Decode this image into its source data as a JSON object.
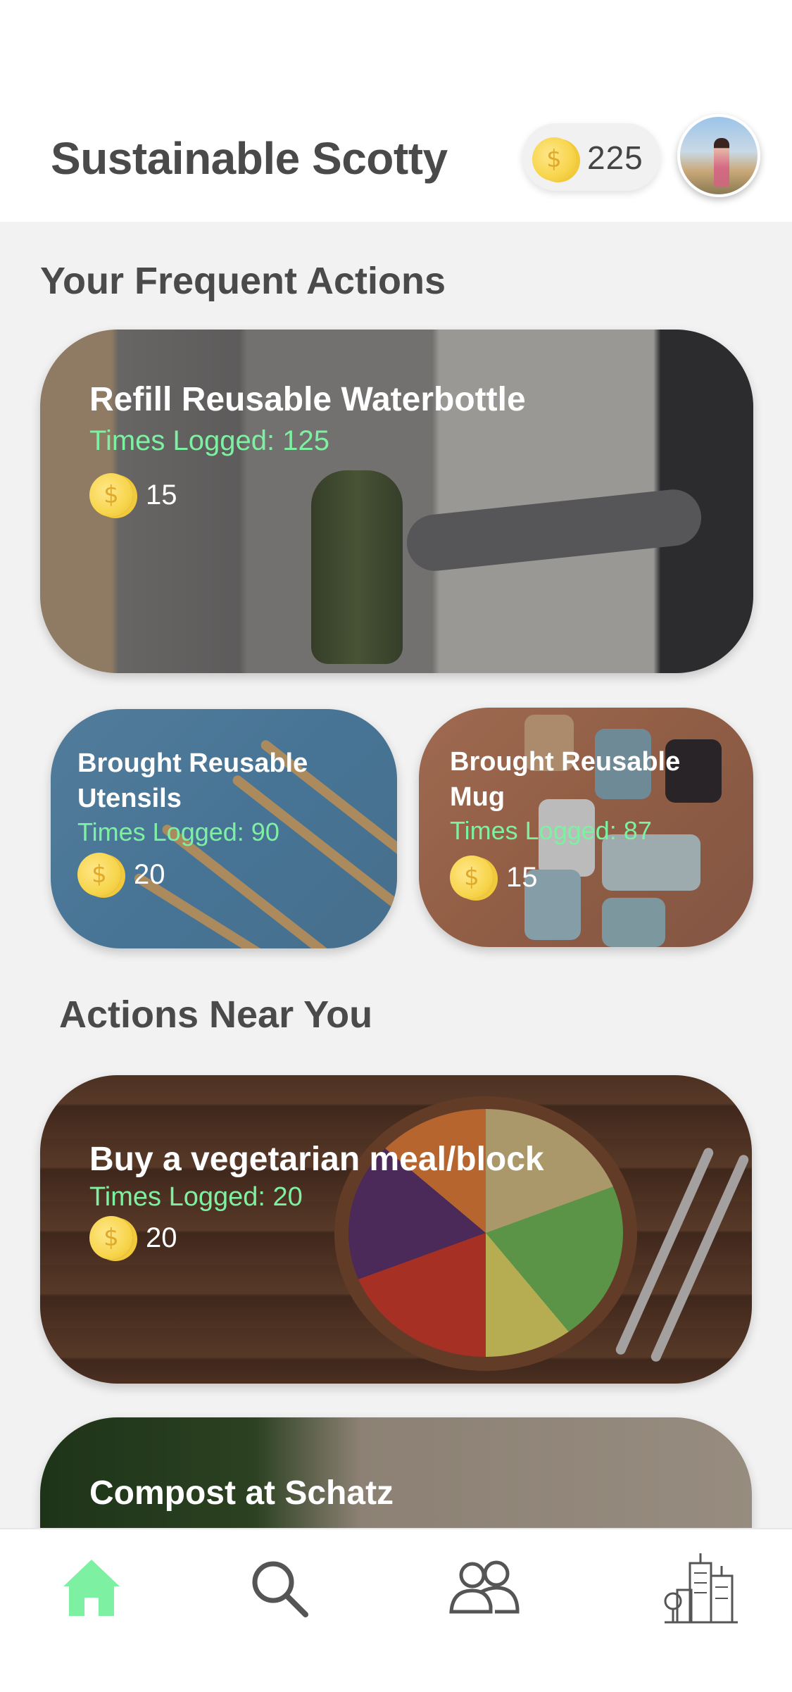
{
  "header": {
    "title": "Sustainable Scotty",
    "coin_balance": "225",
    "coin_symbol": "$"
  },
  "frequent": {
    "section_title": "Your Frequent Actions",
    "cards": [
      {
        "title": "Refill Reusable Waterbottle",
        "logged": "Times Logged: 125",
        "points": "15"
      },
      {
        "title": "Brought Reusable Utensils",
        "logged": "Times Logged: 90",
        "points": "20"
      },
      {
        "title": "Brought Reusable Mug",
        "logged": "Times Logged: 87",
        "points": "15"
      }
    ]
  },
  "nearby": {
    "section_title": "Actions Near You",
    "cards": [
      {
        "title": "Buy a vegetarian meal/block",
        "logged": "Times Logged: 20",
        "points": "20"
      },
      {
        "title": "Compost at Schatz"
      }
    ]
  },
  "tabbar": {
    "active_color": "#7ef0a2",
    "tabs": [
      "home-icon",
      "search-icon",
      "friends-icon",
      "city-icon"
    ]
  },
  "colors": {
    "accent_green": "#7ef0a2",
    "coin_gold": "#f7d54c",
    "text_dark": "#4a4a4a"
  }
}
